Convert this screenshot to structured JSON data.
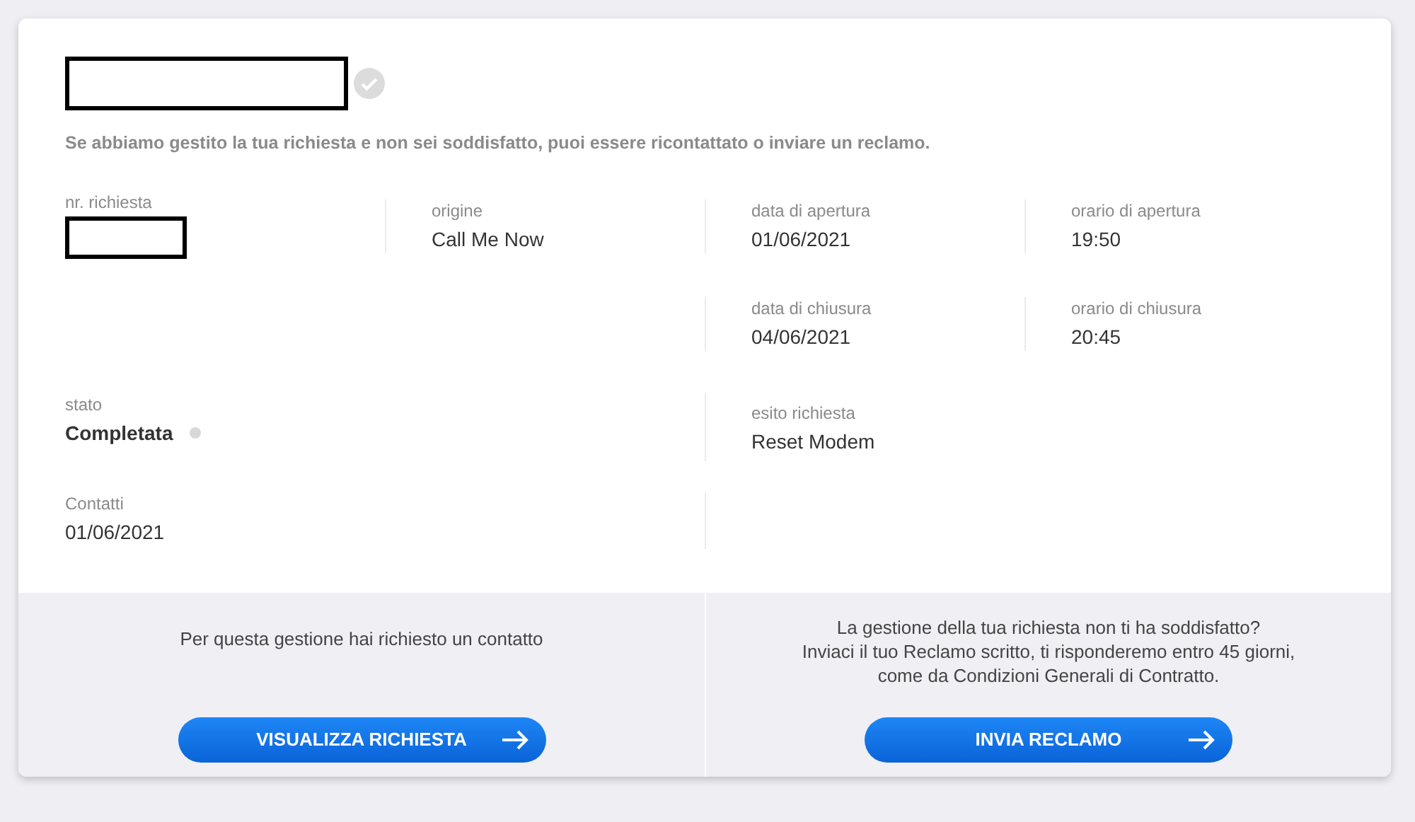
{
  "header": {
    "completed": true,
    "message": "Se abbiamo gestito la tua richiesta e non sei soddisfatto, puoi essere ricontattato o inviare un reclamo."
  },
  "details": {
    "request_number": {
      "label": "nr. richiesta"
    },
    "origin": {
      "label": "origine",
      "value": "Call Me Now"
    },
    "opening_date": {
      "label": "data di apertura",
      "value": "01/06/2021"
    },
    "opening_time": {
      "label": "orario di apertura",
      "value": "19:50"
    },
    "closing_date": {
      "label": "data di chiusura",
      "value": "04/06/2021"
    },
    "closing_time": {
      "label": "orario di chiusura",
      "value": "20:45"
    },
    "status": {
      "label": "stato",
      "value": "Completata"
    },
    "outcome": {
      "label": "esito richiesta",
      "value": "Reset Modem"
    },
    "contacts": {
      "label": "Contatti",
      "value": "01/06/2021"
    }
  },
  "actions": [
    {
      "lines": [
        "Per questa gestione hai richiesto un contatto"
      ],
      "button": "VISUALIZZA RICHIESTA"
    },
    {
      "lines": [
        "La gestione della tua richiesta non ti ha soddisfatto?",
        "Inviaci il tuo Reclamo scritto, ti risponderemo entro 45 giorni,",
        "come da Condizioni Generali di Contratto."
      ],
      "button": "INVIA RECLAMO"
    }
  ]
}
